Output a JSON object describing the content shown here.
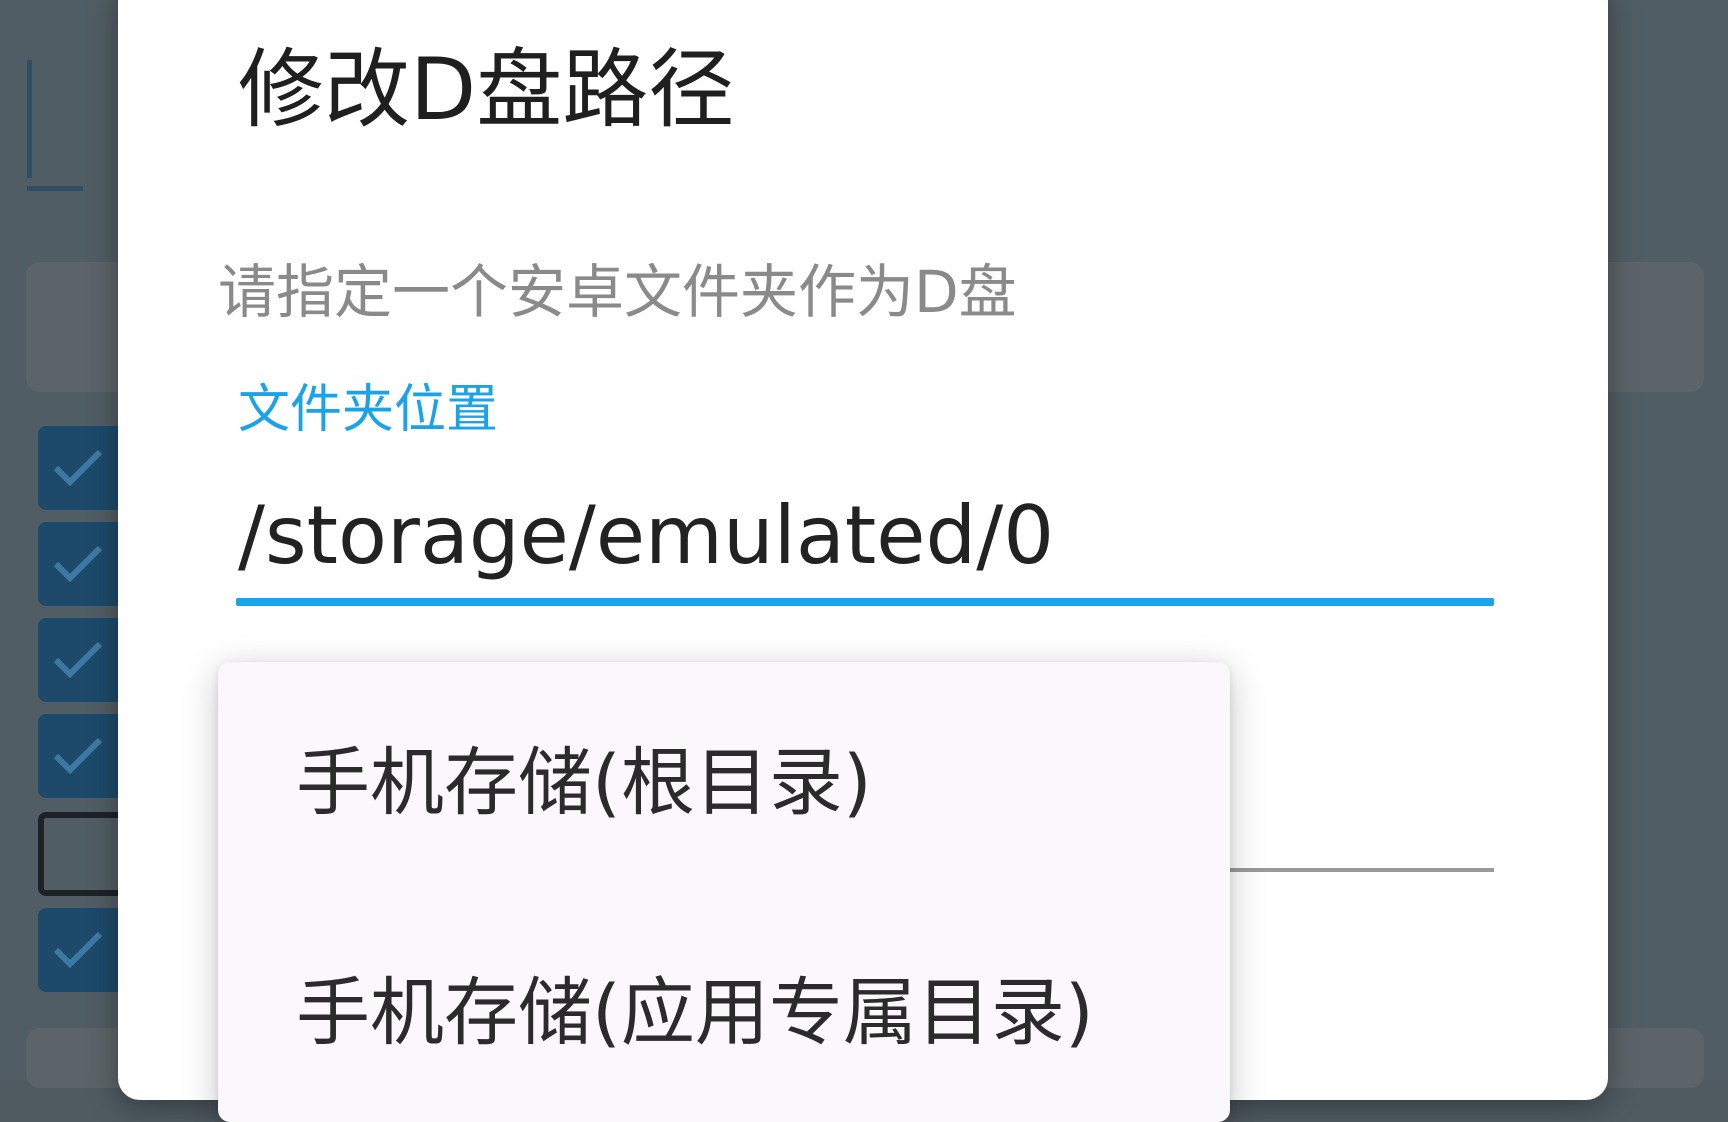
{
  "dialog": {
    "title": "修改D盘路径",
    "message": "请指定一个安卓文件夹作为D盘",
    "field_label": "文件夹位置",
    "path_value": "/storage/emulated/0"
  },
  "dropdown": {
    "options": [
      {
        "label": "手机存储(根目录)"
      },
      {
        "label": "手机存储(应用专属目录)"
      }
    ]
  },
  "background": {
    "checkboxes": [
      {
        "checked": true
      },
      {
        "checked": true
      },
      {
        "checked": true
      },
      {
        "checked": true
      },
      {
        "checked": false
      },
      {
        "checked": true
      }
    ]
  },
  "colors": {
    "accent": "#1aa3e8",
    "scrim": "#515d64",
    "checkbox_fill": "#1d4a6b",
    "dialog_bg": "#ffffff",
    "popup_bg": "#fbf8fb"
  }
}
